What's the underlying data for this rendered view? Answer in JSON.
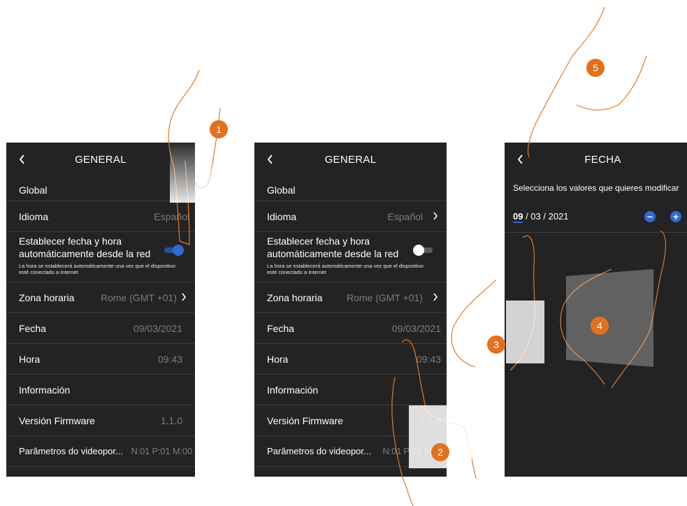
{
  "screens": {
    "general": {
      "title": "GENERAL",
      "back_icon": "chevron-left-icon",
      "section_global": "Global",
      "language_label": "Idioma",
      "language_value": "Español",
      "auto_label": "Establecer fecha y hora automáticamente desde la red",
      "auto_note": "La hora se establecerá automáticamente una vez que el dispositivo esté conectado a Internet",
      "timezone_label": "Zona horaria",
      "timezone_value": "Rome (GMT +01)",
      "date_label": "Fecha",
      "date_value": "09/03/2021",
      "time_label": "Hora",
      "time_value": "09:43",
      "section_info": "Información",
      "firmware_label": "Versión Firmware",
      "firmware_value": "1.1.0",
      "params_label": "Parâmetros do videopor...",
      "params_value": "N:01 P:01 M:00"
    },
    "fecha": {
      "title": "FECHA",
      "prompt": "Selecciona los valores que quieres modificar",
      "day": "09",
      "rest": " / 03 / 2021",
      "minus_symbol": "−",
      "plus_symbol": "+"
    }
  },
  "toggles": {
    "screen1_auto": true,
    "screen2_auto": false
  },
  "colors": {
    "screen_bg": "#232323",
    "accent": "#2e6ad7",
    "marker": "#e2711d",
    "muted": "#7c7c7c"
  },
  "markers": [
    "1",
    "2",
    "3",
    "4",
    "5"
  ]
}
